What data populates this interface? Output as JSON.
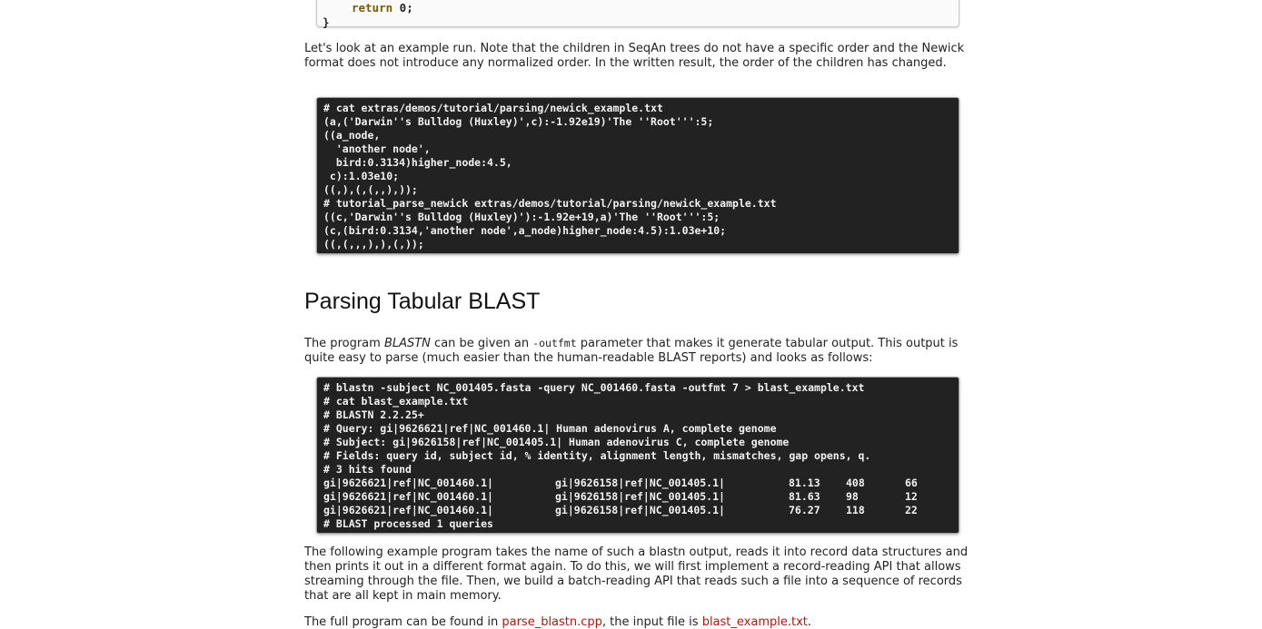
{
  "top_code": {
    "return_kw": "return",
    "return_val": " 0;",
    "closing_brace": "}"
  },
  "para1": "Let's look at an example run. Note that the children in SeqAn trees do not have a specific order and the Newick format does not introduce any normalized order. In the written result, the order of the children has changed.",
  "newick_console": [
    "# cat extras/demos/tutorial/parsing/newick_example.txt",
    "(a,('Darwin''s Bulldog (Huxley)',c):-1.92e19)'The ''Root''':5;",
    "((a_node,",
    "  'another node',",
    "  bird:0.3134)higher_node:4.5,",
    " c):1.03e10;",
    "((,),(,(,,),));",
    "# tutorial_parse_newick extras/demos/tutorial/parsing/newick_example.txt",
    "((c,'Darwin''s Bulldog (Huxley)'):-1.92e+19,a)'The ''Root''':5;",
    "(c,(bird:0.3134,'another node',a_node)higher_node:4.5):1.03e+10;",
    "((,(,,,),),(,));"
  ],
  "heading": "Parsing Tabular BLAST",
  "para2": {
    "pre": "The program ",
    "program": "BLASTN",
    "mid": " can be given an ",
    "param": "-outfmt",
    "post": " parameter that makes it generate tabular output. This output is quite easy to parse (much easier than the human-readable BLAST reports) and looks as follows:"
  },
  "blast_console_header": [
    "# blastn -subject NC_001405.fasta -query NC_001460.fasta -outfmt 7 > blast_example.txt",
    "# cat blast_example.txt",
    "# BLASTN 2.2.25+",
    "# Query: gi|9626621|ref|NC_001460.1| Human adenovirus A, complete genome",
    "# Subject: gi|9626158|ref|NC_001405.1| Human adenovirus C, complete genome",
    "# Fields: query id, subject id, % identity, alignment length, mismatches, gap opens, q.",
    "# 3 hits found"
  ],
  "blast_hits": [
    {
      "query": "gi|9626621|ref|NC_001460.1|",
      "subject": "gi|9626158|ref|NC_001405.1|",
      "identity": "81.13",
      "length": "408",
      "mismatches": "66"
    },
    {
      "query": "gi|9626621|ref|NC_001460.1|",
      "subject": "gi|9626158|ref|NC_001405.1|",
      "identity": "81.63",
      "length": "98",
      "mismatches": "12"
    },
    {
      "query": "gi|9626621|ref|NC_001460.1|",
      "subject": "gi|9626158|ref|NC_001405.1|",
      "identity": "76.27",
      "length": "118",
      "mismatches": "22"
    }
  ],
  "blast_console_footer": "# BLAST processed 1 queries",
  "para3": "The following example program takes the name of such a blastn output, reads it into record data structures and then prints it out in a different format again. To do this, we will first implement a record-reading API that allows streaming through the file. Then, we build a batch-reading API that reads such a file into a sequence of records that are all kept in main memory.",
  "para4": {
    "pre": "The full program can be found in ",
    "link1": "parse_blastn.cpp",
    "mid": ", the input file is ",
    "link2": "blast_example.txt",
    "post": "."
  }
}
